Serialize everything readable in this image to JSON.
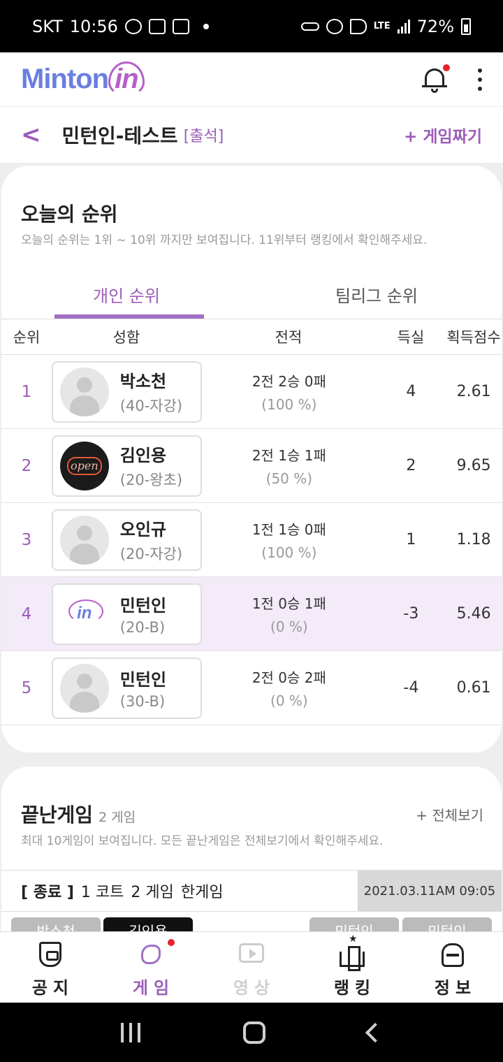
{
  "status_bar": {
    "carrier": "SKT",
    "time": "10:56",
    "network": "LTE",
    "battery": "72%"
  },
  "header": {
    "logo_main": "Minton",
    "logo_accent": "in"
  },
  "subheader": {
    "back": "<",
    "title": "민턴인-테스트",
    "attendance": "[출석]",
    "make_game": "+ 게임짜기"
  },
  "ranking": {
    "title": "오늘의 순위",
    "description": "오늘의 순위는 1위 ~ 10위 까지만 보여집니다. 11위부터 랭킹에서 확인해주세요.",
    "tabs": [
      {
        "label": "개인 순위",
        "active": true
      },
      {
        "label": "팀리그 순위",
        "active": false
      }
    ],
    "columns": {
      "rank": "순위",
      "name": "성함",
      "record": "전적",
      "diff": "득실",
      "score": "획득점수"
    },
    "rows": [
      {
        "rank": "1",
        "name": "박소천",
        "group": "(40-자강)",
        "record": "2전 2승 0패",
        "pct": "(100 %)",
        "diff": "4",
        "score": "2.61",
        "avatar": "default"
      },
      {
        "rank": "2",
        "name": "김인용",
        "group": "(20-왕초)",
        "record": "2전 1승 1패",
        "pct": "(50 %)",
        "diff": "2",
        "score": "9.65",
        "avatar": "open-sign",
        "avatar_text": "open"
      },
      {
        "rank": "3",
        "name": "오인규",
        "group": "(20-자강)",
        "record": "1전 1승 0패",
        "pct": "(100 %)",
        "diff": "1",
        "score": "1.18",
        "avatar": "default"
      },
      {
        "rank": "4",
        "name": "민턴인",
        "group": "(20-B)",
        "record": "1전 0승 1패",
        "pct": "(0 %)",
        "diff": "-3",
        "score": "5.46",
        "avatar": "mintonin-logo",
        "avatar_text": "in"
      },
      {
        "rank": "5",
        "name": "민턴인",
        "group": "(30-B)",
        "record": "2전 0승 2패",
        "pct": "(0 %)",
        "diff": "-4",
        "score": "0.61",
        "avatar": "default"
      }
    ]
  },
  "ended_games": {
    "title": "끝난게임",
    "count": "2 게임",
    "view_all": "+ 전체보기",
    "description": "최대 10게임이 보여집니다. 모든 끝난게임은 전체보기에서 확인해주세요.",
    "game": {
      "status": "[ 종료 ]",
      "court": "1 코트",
      "game_no": "2 게임",
      "type": "한게임",
      "datetime": "2021.03.11AM 09:05"
    },
    "players": [
      "박소천",
      "김인용",
      "민턴인",
      "민턴인"
    ]
  },
  "bottom_nav": [
    {
      "label": "공지",
      "icon": "notice-icon"
    },
    {
      "label": "게임",
      "icon": "game-icon",
      "active": true
    },
    {
      "label": "영상",
      "icon": "video-icon",
      "disabled": true
    },
    {
      "label": "랭킹",
      "icon": "ranking-icon"
    },
    {
      "label": "정보",
      "icon": "info-icon"
    }
  ],
  "colors": {
    "accent": "#9b5cb8",
    "highlight_row": "#f4ebf9",
    "badge": "#e8232e"
  }
}
